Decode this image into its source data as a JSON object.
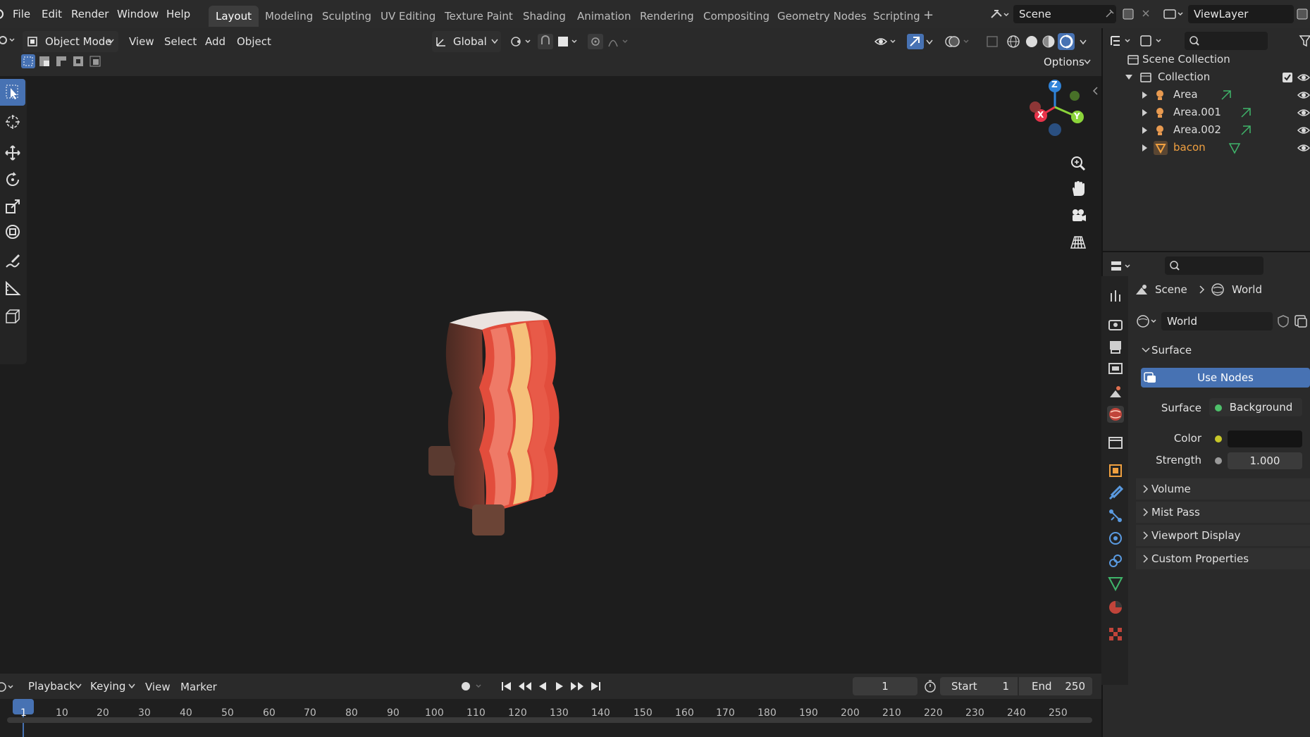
{
  "menubar": {
    "items": [
      "File",
      "Edit",
      "Render",
      "Window",
      "Help"
    ],
    "workspaces": [
      "Layout",
      "Modeling",
      "Sculpting",
      "UV Editing",
      "Texture Paint",
      "Shading",
      "Animation",
      "Rendering",
      "Compositing",
      "Geometry Nodes",
      "Scripting"
    ],
    "active_workspace": "Layout",
    "scene": "Scene",
    "view_layer": "ViewLayer"
  },
  "viewport_header": {
    "mode": "Object Mode",
    "menus": [
      "View",
      "Select",
      "Add",
      "Object"
    ],
    "orientation": "Global",
    "options": "Options"
  },
  "gizmo": {
    "x": "X",
    "y": "Y",
    "z": "Z"
  },
  "outliner": {
    "root": "Scene Collection",
    "collection": "Collection",
    "items": [
      {
        "name": "Area",
        "type": "light"
      },
      {
        "name": "Area.001",
        "type": "light"
      },
      {
        "name": "Area.002",
        "type": "light"
      },
      {
        "name": "bacon",
        "type": "mesh"
      }
    ]
  },
  "properties": {
    "breadcrumb": [
      "Scene",
      "World"
    ],
    "world_name": "World",
    "surface_panel": "Surface",
    "use_nodes": "Use Nodes",
    "surface_label": "Surface",
    "surface_value": "Background",
    "color_label": "Color",
    "strength_label": "Strength",
    "strength_value": "1.000",
    "panels": [
      "Volume",
      "Mist Pass",
      "Viewport Display",
      "Custom Properties"
    ]
  },
  "timeline": {
    "menus": [
      "Playback",
      "Keying",
      "View",
      "Marker"
    ],
    "current_frame": "1",
    "start_label": "Start",
    "start_value": "1",
    "end_label": "End",
    "end_value": "250",
    "ticks": [
      "1",
      "10",
      "20",
      "30",
      "40",
      "50",
      "60",
      "70",
      "80",
      "90",
      "100",
      "110",
      "120",
      "130",
      "140",
      "150",
      "160",
      "170",
      "180",
      "190",
      "200",
      "210",
      "220",
      "230",
      "240",
      "250"
    ]
  },
  "colors": {
    "accent": "#4772b3",
    "active_object": "#f0a040",
    "x_axis": "#e8334a",
    "y_axis": "#8bd43a",
    "z_axis": "#2f83d9"
  }
}
